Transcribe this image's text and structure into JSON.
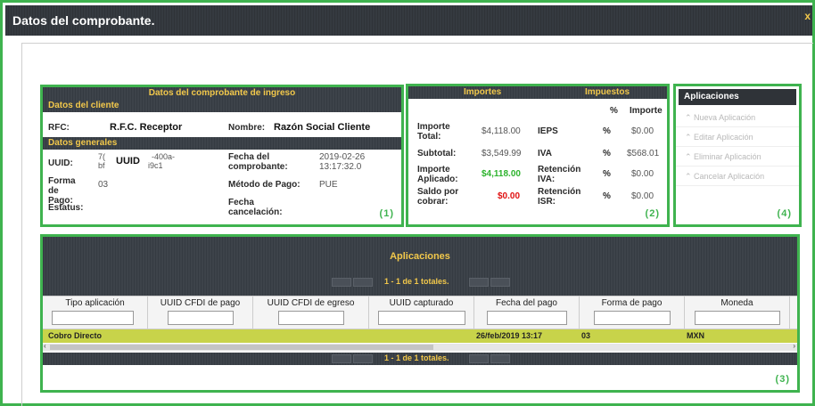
{
  "window": {
    "title": "Datos del comprobante.",
    "close": "x"
  },
  "box1": {
    "header": "Datos del comprobante de ingreso",
    "client_section": "Datos del cliente",
    "rfc_label": "RFC:",
    "rfc_value": "R.F.C. Receptor",
    "nombre_label": "Nombre:",
    "nombre_value": "Razón Social Cliente",
    "general_section": "Datos generales",
    "uuid_label": "UUID:",
    "uuid_frag1": "7(",
    "uuid_frag2": "bf",
    "uuid_big": "UUID",
    "uuid_frag3": "-400a-",
    "uuid_frag4": "i9c1",
    "fecha_comp_label": "Fecha del comprobante:",
    "fecha_comp_value": "2019-02-26 13:17:32.0",
    "forma_pago_label": "Forma de Pago:",
    "forma_pago_value": "03",
    "metodo_pago_label": "Método de Pago:",
    "metodo_pago_value": "PUE",
    "estatus_label": "Estatus:",
    "fecha_cancel_label": "Fecha cancelación:",
    "marker": "(1)"
  },
  "box2": {
    "header_importes": "Importes",
    "header_impuestos": "Impuestos",
    "col_pct": "%",
    "col_importe": "Importe",
    "rows": [
      {
        "label": "Importe Total:",
        "amount": "$4,118.00",
        "tax": "IEPS",
        "pct": "%",
        "tax_amount": "$0.00"
      },
      {
        "label": "Subtotal:",
        "amount": "$3,549.99",
        "tax": "IVA",
        "pct": "%",
        "tax_amount": "$568.01"
      },
      {
        "label": "Importe Aplicado:",
        "amount": "$4,118.00",
        "tax": "Retención IVA:",
        "pct": "%",
        "tax_amount": "$0.00"
      },
      {
        "label": "Saldo por cobrar:",
        "amount": "$0.00",
        "tax": "Retención ISR:",
        "pct": "%",
        "tax_amount": "$0.00"
      }
    ],
    "colors": {
      "aplicado": "#2db32d",
      "saldo": "#e01010"
    },
    "marker": "(2)"
  },
  "box4": {
    "header": "Aplicaciones",
    "items": [
      "Nueva Aplicación",
      "Editar Aplicación",
      "Eliminar Aplicación",
      "Cancelar Aplicación"
    ],
    "marker": "(4)"
  },
  "box3": {
    "title": "Aplicaciones",
    "pager_text": "1 - 1 de 1 totales.",
    "columns": [
      "Tipo aplicación",
      "UUID CFDI de pago",
      "UUID CFDI de egreso",
      "UUID capturado",
      "Fecha del pago",
      "Forma de pago",
      "Moneda"
    ],
    "row": {
      "tipo": "Cobro Directo",
      "fecha": "26/feb/2019 13:17",
      "forma": "03",
      "moneda": "MXN"
    },
    "marker": "(3)"
  },
  "accent_color": "#3fb34f",
  "header_text_color": "#f2c84b"
}
